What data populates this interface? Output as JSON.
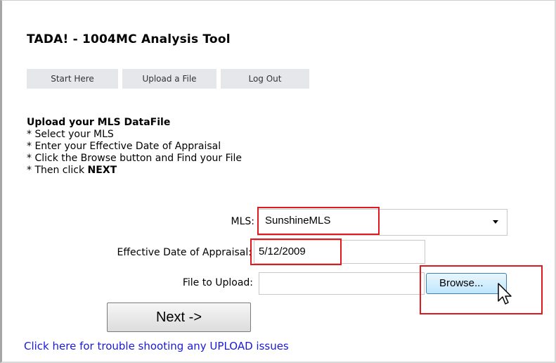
{
  "page": {
    "title": "TADA! - 1004MC Analysis Tool"
  },
  "nav": [
    {
      "label": "Start Here"
    },
    {
      "label": "Upload a File"
    },
    {
      "label": "Log Out"
    }
  ],
  "instructions": {
    "heading": "Upload your MLS DataFile",
    "lines": [
      "* Select your MLS",
      "* Enter your Effective Date of Appraisal",
      "* Click the Browse button and Find your File"
    ],
    "last_line_prefix": "* Then click ",
    "last_line_bold": "NEXT"
  },
  "form": {
    "mls_label": "MLS:",
    "mls_selected": "SunshineMLS",
    "date_label": "Effective Date of Appraisal:",
    "date_value": "5/12/2009",
    "file_label": "File to Upload:",
    "browse_label": "Browse..."
  },
  "next_button": "Next ->",
  "help_link": "Click here for trouble shooting any UPLOAD issues",
  "colors": {
    "highlight": "#e0191e",
    "link": "#1a1adb",
    "nav_bg": "#e5e8ea",
    "browse_bg": "#bee6fd"
  }
}
